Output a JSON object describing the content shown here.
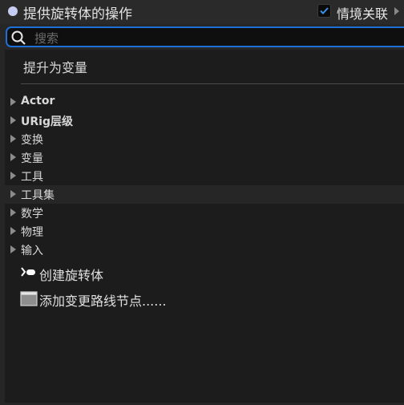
{
  "header": {
    "title": "提供旋转体的操作",
    "context_label": "情境关联",
    "context_checked": true
  },
  "search": {
    "placeholder": "搜索",
    "value": ""
  },
  "promote_label": "提升为变量",
  "categories": [
    {
      "label": "Actor"
    },
    {
      "label": "URig层级"
    },
    {
      "label": "变换"
    },
    {
      "label": "变量"
    },
    {
      "label": "工具"
    },
    {
      "label": "工具集"
    },
    {
      "label": "数学"
    },
    {
      "label": "物理"
    },
    {
      "label": "输入"
    }
  ],
  "actions": [
    {
      "label": "创建旋转体",
      "icon": "node-pin-icon"
    },
    {
      "label": "添加变更路线节点......",
      "icon": "reroute-node-icon"
    }
  ],
  "colors": {
    "accent": "#1f6fd6",
    "check": "#3b8fe8",
    "pin": "#c6cdf2"
  }
}
